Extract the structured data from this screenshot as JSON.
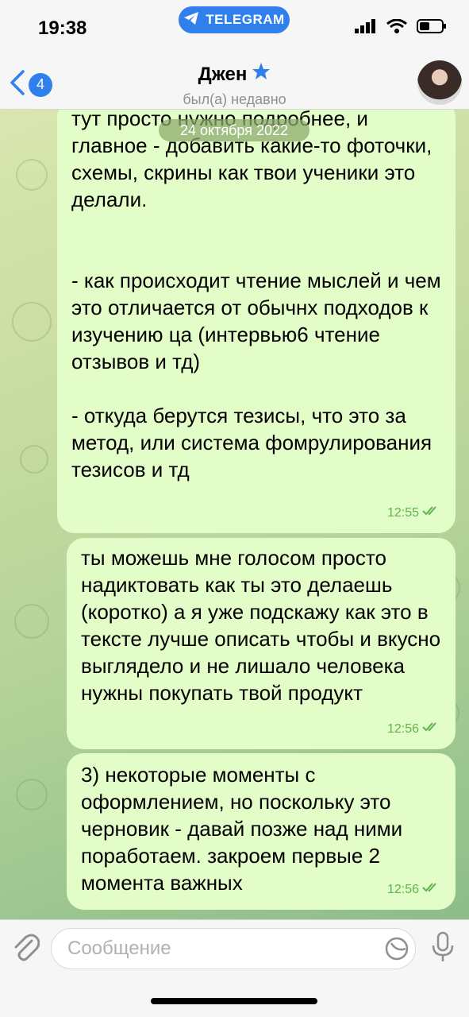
{
  "status_bar": {
    "time": "19:38",
    "app_pill": "TELEGRAM"
  },
  "header": {
    "back_count": "4",
    "contact_name": "Джен",
    "contact_status": "был(а) недавно"
  },
  "date_label": "24 октября 2022",
  "messages": [
    {
      "text": "тут просто нужно подробнее, и главное - добавить какие-то фоточки, схемы, скрины как твои ученики это делали.\n\n\n- как происходит чтение мыслей и чем это отличается от обычнх подходов к изучению ца (интервью6 чтение отзывов и тд)\n\n- откуда берутся тезисы, что это за метод, или система фомрулирования тезисов и тд",
      "time": "12:55"
    },
    {
      "text": "ты можешь мне голосом просто надиктовать как ты это делаешь (коротко) а я уже подскажу как это в тексте лучше описать чтобы и вкусно выглядело и не лишало человека нужны покупать твой продукт",
      "time": "12:56"
    },
    {
      "text": "3) некоторые моменты с оформлением, но поскольку это черновик - давай позже над ними поработаем. закроем первые 2 момента важных",
      "time": "12:56"
    }
  ],
  "input": {
    "placeholder": "Сообщение"
  },
  "colors": {
    "accent": "#2f80ed",
    "bubble": "#e3fdc8",
    "read_check": "#5fb34e"
  }
}
